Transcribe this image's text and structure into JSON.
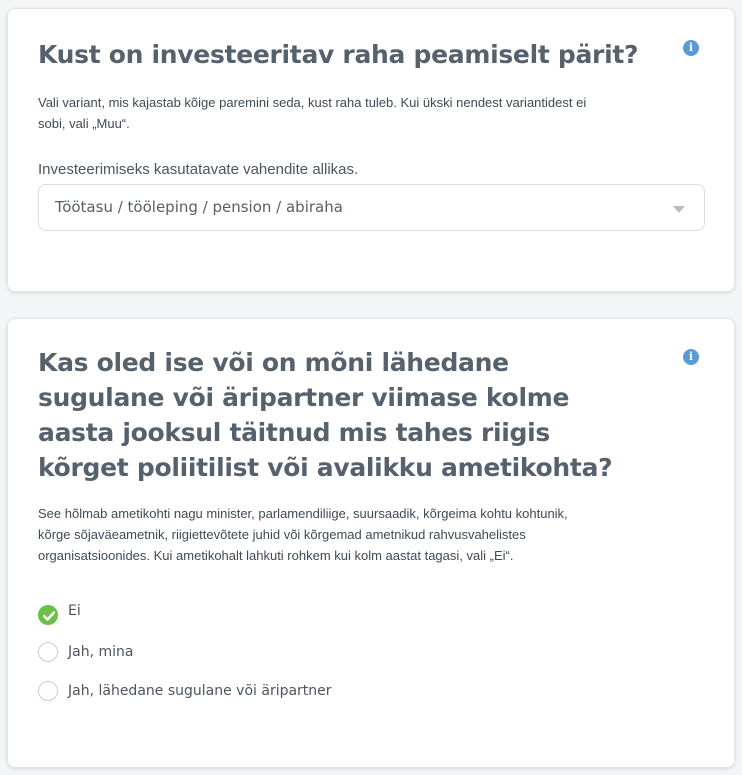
{
  "colors": {
    "accent_blue": "#5b9ad8",
    "check_green": "#6cc04a",
    "title_gray": "#55616c"
  },
  "question1": {
    "title": "Kust on investeeritav raha peamiselt pärit?",
    "description": "Vali variant, mis kajastab kõige paremini seda, kust raha tuleb. Kui ükski nendest variantidest ei sobi, vali „Muu“.",
    "info_icon": "info-icon",
    "field_label": "Investeerimiseks kasutatavate vahendite allikas.",
    "selected_value": "Töötasu / tööleping / pension / abiraha"
  },
  "question2": {
    "title": "Kas oled ise või on mõni lähedane sugulane või äripartner viimase kolme aasta jooksul täitnud mis tahes riigis kõrget poliitilist või avalikku ametikohta?",
    "description": "See hõlmab ametikohti nagu minister, parlamendiliige, suursaadik, kõrgeima kohtu kohtunik, kõrge sõjaväeametnik, riigiettevõtete juhid või kõrgemad ametnikud rahvusvahelistes organisatsioonides. Kui ametikohalt lahkuti rohkem kui kolm aastat tagasi, vali „Ei“.",
    "info_icon": "info-icon",
    "options": [
      {
        "label": "Ei",
        "selected": true
      },
      {
        "label": "Jah, mina",
        "selected": false
      },
      {
        "label": "Jah, lähedane sugulane või äripartner",
        "selected": false
      }
    ]
  }
}
